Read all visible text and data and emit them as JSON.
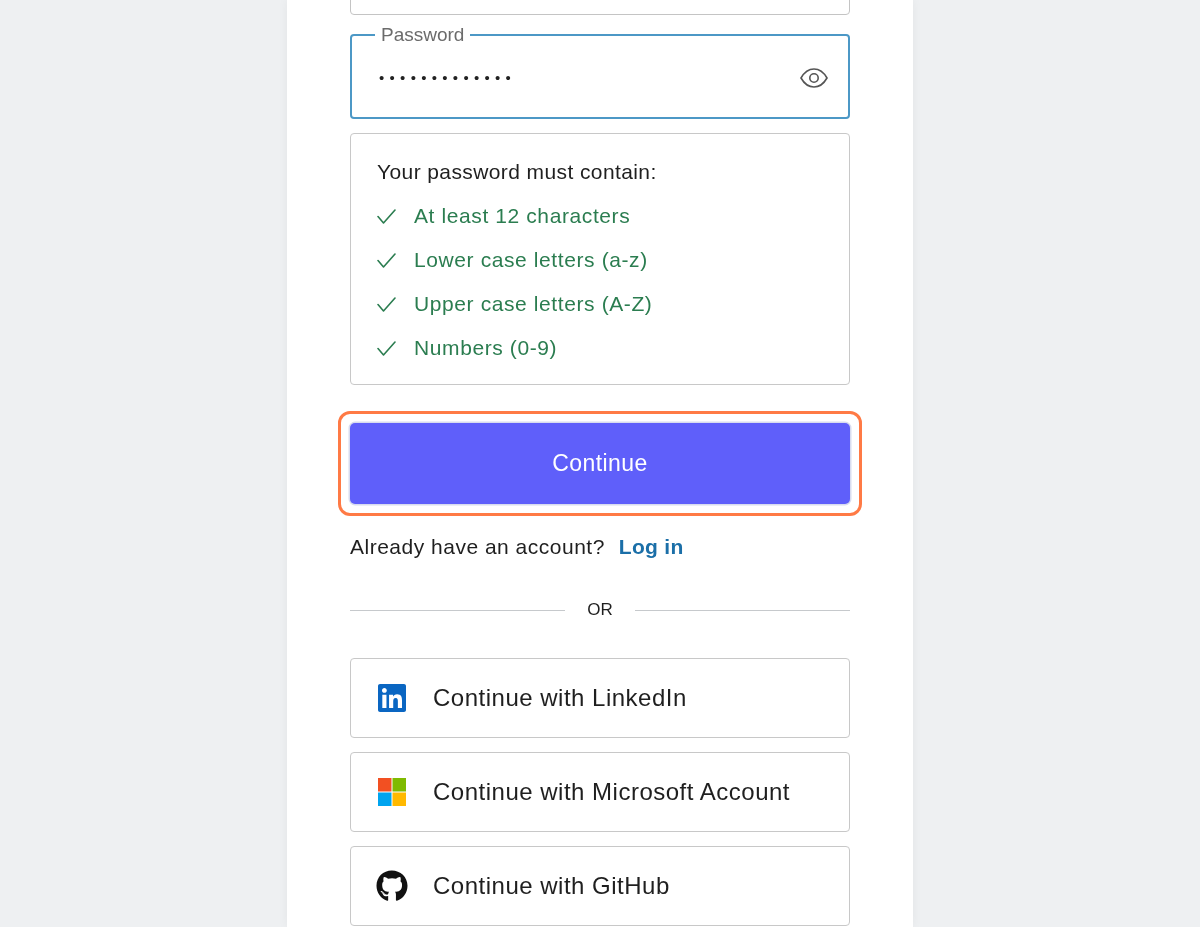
{
  "password_field": {
    "label": "Password",
    "value": "•••••••••••••",
    "focused": true
  },
  "requirements": {
    "title": "Your password must contain:",
    "items": [
      {
        "text": "At least 12 characters",
        "met": true
      },
      {
        "text": "Lower case letters (a-z)",
        "met": true
      },
      {
        "text": "Upper case letters (A-Z)",
        "met": true
      },
      {
        "text": "Numbers (0-9)",
        "met": true
      }
    ]
  },
  "continue_button": {
    "label": "Continue",
    "focused": true
  },
  "login_prompt": {
    "text": "Already have an account?",
    "link": "Log in"
  },
  "divider": {
    "text": "OR"
  },
  "social_buttons": [
    {
      "kind": "linkedin",
      "label": "Continue with LinkedIn"
    },
    {
      "kind": "microsoft",
      "label": "Continue with Microsoft Account"
    },
    {
      "kind": "github",
      "label": "Continue with GitHub"
    }
  ]
}
